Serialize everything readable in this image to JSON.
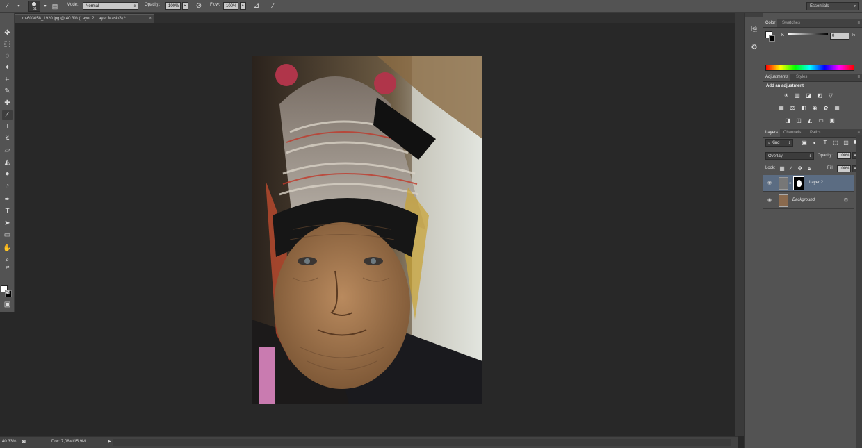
{
  "options_bar": {
    "brush_size": "51",
    "mode_label": "Mode:",
    "mode_value": "Normal",
    "opacity_label": "Opacity:",
    "opacity_value": "100%",
    "flow_label": "Flow:",
    "flow_value": "100%",
    "workspace": "Essentials"
  },
  "document": {
    "tab_title": "m-603058_1920.jpg @ 40.3% (Layer 2, Layer Mask/8) *"
  },
  "status": {
    "zoom": "40.33%",
    "doc_size": "Doc: 7,08M/15,9M"
  },
  "color_panel": {
    "tabs": [
      "Color",
      "Swatches"
    ],
    "k_label": "K",
    "k_value": "0",
    "k_unit": "%"
  },
  "adjustments_panel": {
    "tabs": [
      "Adjustments",
      "Styles"
    ],
    "heading": "Add an adjustment",
    "icon_rows": [
      [
        "brightness-icon",
        "levels-icon",
        "curves-icon",
        "exposure-icon",
        "vibrance-icon"
      ],
      [
        "hue-icon",
        "color-balance-icon",
        "bw-icon",
        "photo-filter-icon",
        "channel-mixer-icon",
        "color-lookup-icon"
      ],
      [
        "invert-icon",
        "posterize-icon",
        "threshold-icon",
        "gradient-map-icon",
        "selective-color-icon"
      ]
    ]
  },
  "layers_panel": {
    "tabs": [
      "Layers",
      "Channels",
      "Paths"
    ],
    "kind_label": "Kind",
    "blend_mode": "Overlay",
    "opacity_label": "Opacity:",
    "opacity_value": "100%",
    "lock_label": "Lock:",
    "fill_label": "Fill:",
    "fill_value": "100%",
    "layers": [
      {
        "name": "Layer 2",
        "selected": true,
        "has_mask": true
      },
      {
        "name": "Background",
        "selected": false,
        "locked": true
      }
    ]
  },
  "colors": {
    "ui_dark": "#282828",
    "ui_panel": "#535353",
    "selection": "#5b6c82"
  }
}
